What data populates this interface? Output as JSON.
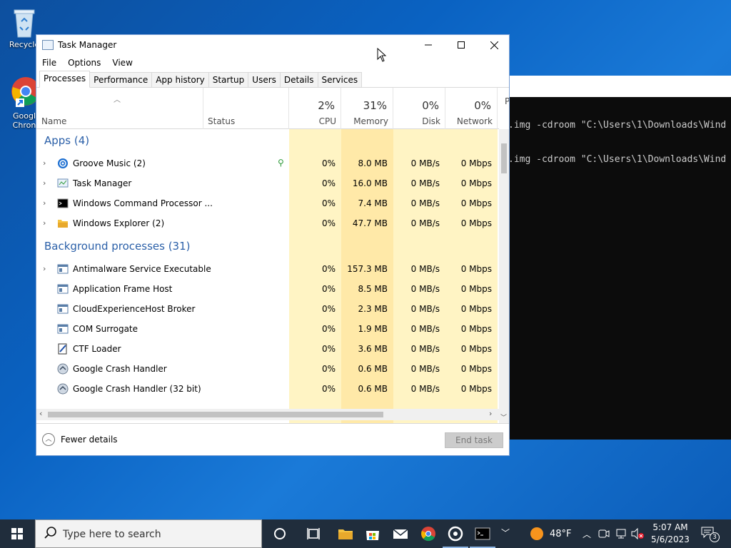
{
  "desktop": {
    "icons": [
      {
        "label": "Recycle"
      },
      {
        "label": "Googl Chron"
      }
    ]
  },
  "cmd": {
    "lines": [
      ".img -cdroom \"C:\\Users\\1\\Downloads\\Wind",
      ".img -cdroom \"C:\\Users\\1\\Downloads\\Wind"
    ]
  },
  "task_manager": {
    "title": "Task Manager",
    "menu": [
      "File",
      "Options",
      "View"
    ],
    "tabs": [
      "Processes",
      "Performance",
      "App history",
      "Startup",
      "Users",
      "Details",
      "Services"
    ],
    "active_tab": "Processes",
    "columns": {
      "name": "Name",
      "status": "Status",
      "cpu": {
        "label": "CPU",
        "pct": "2%"
      },
      "memory": {
        "label": "Memory",
        "pct": "31%"
      },
      "disk": {
        "label": "Disk",
        "pct": "0%"
      },
      "network": {
        "label": "Network",
        "pct": "0%"
      },
      "power_partial": "P"
    },
    "groups": {
      "apps": "Apps (4)",
      "background": "Background processes (31)"
    },
    "apps": [
      {
        "name": "Groove Music (2)",
        "cpu": "0%",
        "memory": "8.0 MB",
        "disk": "0 MB/s",
        "network": "0 Mbps",
        "expand": true,
        "icon": "groove-music-icon",
        "suspended_leaf": true
      },
      {
        "name": "Task Manager",
        "cpu": "0%",
        "memory": "16.0 MB",
        "disk": "0 MB/s",
        "network": "0 Mbps",
        "expand": true,
        "icon": "task-manager-icon"
      },
      {
        "name": "Windows Command Processor ...",
        "cpu": "0%",
        "memory": "7.4 MB",
        "disk": "0 MB/s",
        "network": "0 Mbps",
        "expand": true,
        "icon": "cmd-icon"
      },
      {
        "name": "Windows Explorer (2)",
        "cpu": "0%",
        "memory": "47.7 MB",
        "disk": "0 MB/s",
        "network": "0 Mbps",
        "expand": true,
        "icon": "folder-icon"
      }
    ],
    "background": [
      {
        "name": "Antimalware Service Executable",
        "cpu": "0%",
        "memory": "157.3 MB",
        "disk": "0 MB/s",
        "network": "0 Mbps",
        "expand": true,
        "icon": "service-icon"
      },
      {
        "name": "Application Frame Host",
        "cpu": "0%",
        "memory": "8.5 MB",
        "disk": "0 MB/s",
        "network": "0 Mbps",
        "expand": false,
        "icon": "service-icon"
      },
      {
        "name": "CloudExperienceHost Broker",
        "cpu": "0%",
        "memory": "2.3 MB",
        "disk": "0 MB/s",
        "network": "0 Mbps",
        "expand": false,
        "icon": "service-icon"
      },
      {
        "name": "COM Surrogate",
        "cpu": "0%",
        "memory": "1.9 MB",
        "disk": "0 MB/s",
        "network": "0 Mbps",
        "expand": false,
        "icon": "service-icon"
      },
      {
        "name": "CTF Loader",
        "cpu": "0%",
        "memory": "3.6 MB",
        "disk": "0 MB/s",
        "network": "0 Mbps",
        "expand": false,
        "icon": "ctf-loader-icon"
      },
      {
        "name": "Google Crash Handler",
        "cpu": "0%",
        "memory": "0.6 MB",
        "disk": "0 MB/s",
        "network": "0 Mbps",
        "expand": false,
        "icon": "google-crash-icon"
      },
      {
        "name": "Google Crash Handler (32 bit)",
        "cpu": "0%",
        "memory": "0.6 MB",
        "disk": "0 MB/s",
        "network": "0 Mbps",
        "expand": false,
        "icon": "google-crash-icon"
      }
    ],
    "footer": {
      "fewer_details": "Fewer details",
      "end_task": "End task"
    }
  },
  "taskbar": {
    "search_placeholder": "Type here to search",
    "weather": "48°F",
    "time": "5:07 AM",
    "date": "5/6/2023",
    "notification_count": "3"
  }
}
